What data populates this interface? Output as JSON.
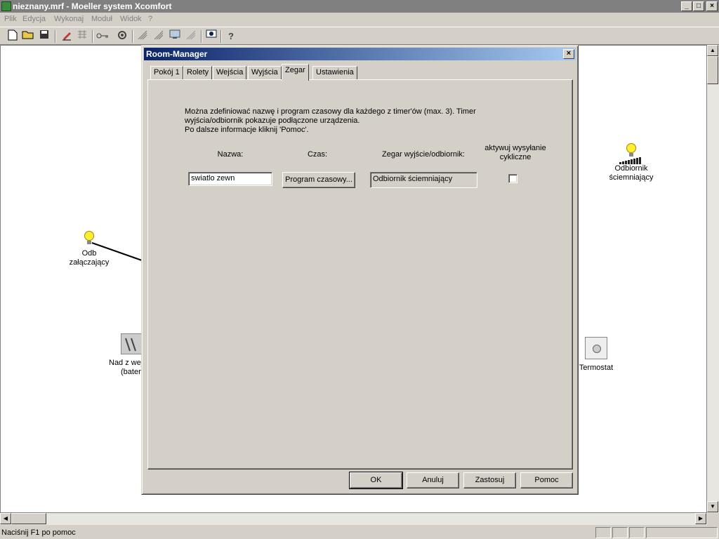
{
  "app": {
    "title": "nieznany.mrf - Moeller system Xcomfort",
    "window_controls": {
      "minimize": "_",
      "maximize": "□",
      "close": "×"
    }
  },
  "menu": [
    "Plik",
    "Edycja",
    "Wykonaj",
    "Moduł",
    "Widok",
    "?"
  ],
  "toolbar": {
    "icons": [
      "new-file-icon",
      "open-folder-icon",
      "save-icon",
      "edit-icon",
      "grid-icon",
      "key-icon",
      "network-icon",
      "sensor-icon",
      "sensor2-icon",
      "monitor-icon",
      "wireless-icon",
      "zoom-window-icon",
      "help-icon"
    ],
    "help_glyph": "?"
  },
  "canvas": {
    "devices": [
      {
        "label_line1": "Odb",
        "label_line2": "załączający",
        "icon": "light-bulb-icon"
      },
      {
        "label_line1": "Odbiornik",
        "label_line2": "ściemniający",
        "icon": "dimmer-bulb-icon"
      },
      {
        "label_line1": "Nad z wej",
        "label_line2": "(bater",
        "icon": "switch-icon"
      },
      {
        "label_line1": "Termostat",
        "label_line2": "",
        "icon": "thermostat-icon"
      }
    ]
  },
  "dialog": {
    "title": "Room-Manager",
    "close": "×",
    "tabs": [
      "Pokój 1",
      "Rolety",
      "Wejścia",
      "Wyjścia",
      "Zegar",
      "Ustawienia"
    ],
    "active_tab": "Zegar",
    "info_text": "Można zdefiniować nazwę i program czasowy dla każdego z timer'ów (max. 3). Timer\nwyjścia/odbiornik pokazuje podłączone urządzenia.\n Po dalsze informacje kliknij 'Pomoc'.",
    "headers": {
      "name": "Nazwa:",
      "time": "Czas:",
      "output": "Zegar wyjście/odbiornik:",
      "cyclic_line1": "aktywuj wysyłanie",
      "cyclic_line2": "cykliczne"
    },
    "row": {
      "name_value": "swiatlo zewn",
      "program_button": "Program czasowy...",
      "output_value": "Odbiornik ściemniający",
      "cyclic_checked": false
    },
    "buttons": {
      "ok": "OK",
      "cancel": "Anuluj",
      "apply": "Zastosuj",
      "help": "Pomoc"
    }
  },
  "statusbar": {
    "message": "Naciśnij F1 po pomoc"
  }
}
